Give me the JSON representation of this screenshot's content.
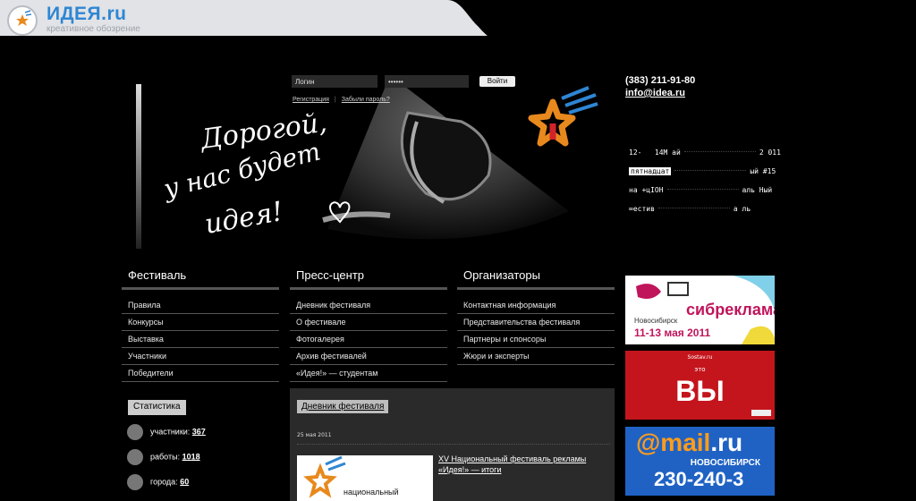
{
  "header": {
    "title": "ИДЕЯ.ru",
    "subtitle": "креативное обозрение"
  },
  "login": {
    "login_value": "Логин",
    "password_value": "••••••",
    "submit_label": "Войти",
    "register_link": "Регистрация",
    "forgot_link": "Забыли пароль?"
  },
  "hero": {
    "line1": "Дорогой,",
    "line2": "у нас будет",
    "line3": "идея!"
  },
  "contact": {
    "phone": "(383) 211-91-80",
    "email": "info@idea.ru"
  },
  "festival_info": {
    "l1a": "12-",
    "l1b": "14М ай",
    "l1c": "2 011",
    "l2a": "пятнадцат",
    "l2b": "ый #15",
    "l3a": "на +цIОН",
    "l3b": "аль Ный",
    "l4a": "∞естив",
    "l4b": "а  ль"
  },
  "columns": {
    "festival": {
      "title": "Фестиваль",
      "items": [
        "Правила",
        "Конкурсы",
        "Выставка",
        "Участники",
        "Победители"
      ]
    },
    "press": {
      "title": "Пресс-центр",
      "items": [
        "Дневник фестиваля",
        "О фестивале",
        "Фотогалерея",
        "Архив фестивалей",
        "«Идея!» — студентам"
      ]
    },
    "organizers": {
      "title": "Организаторы",
      "items": [
        "Контактная информация",
        "Представительства фестиваля",
        "Партнеры и спонсоры",
        "Жюри и эксперты"
      ]
    }
  },
  "stats": {
    "button": "Статистика",
    "participants_label": "участники:",
    "participants_value": "367",
    "works_label": "работы:",
    "works_value": "1018",
    "cities_label": "города:",
    "cities_value": "60"
  },
  "diary": {
    "button": "Дневник фестиваля",
    "date": "25 мая 2011",
    "thumb_text": "национальный",
    "link": "XV Национальный фестиваль рекламы «Идея!» — итоги"
  },
  "ads": {
    "ad1_title": "сибреклама",
    "ad1_city": "Новосибирск",
    "ad1_date": "11-13 мая 2011",
    "ad2_top": "Sostav.ru",
    "ad2_eto": "это",
    "ad2_big": "ВЫ",
    "ad3_mail": "@mail",
    "ad3_ru": ".ru",
    "ad3_city": "НОВОСИБИРСК",
    "ad3_phone": "230-240-3"
  },
  "colors": {
    "brand_blue": "#2f86d3",
    "ad_magenta": "#c0145b",
    "ad_red": "#c4151c",
    "ad_blue": "#1f62c4"
  }
}
